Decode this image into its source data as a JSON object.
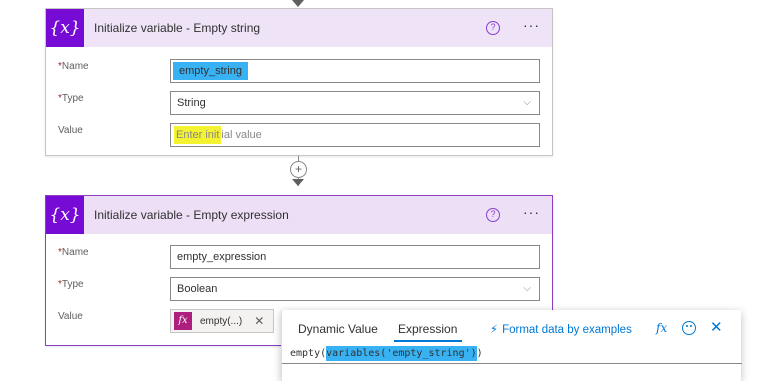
{
  "card1": {
    "title": "Initialize variable - Empty string",
    "icon_text": "{x}",
    "name_label": "Name",
    "name_value": "empty_string",
    "type_label": "Type",
    "type_value": "String",
    "value_label": "Value",
    "value_placeholder": "Enter initial value"
  },
  "card2": {
    "title": "Initialize variable - Empty expression",
    "icon_text": "{x}",
    "name_label": "Name",
    "name_value": "empty_expression",
    "type_label": "Type",
    "type_value": "Boolean",
    "value_label": "Value",
    "token_text": "empty(...)",
    "token_badge": "fx"
  },
  "popup": {
    "tab_dynamic": "Dynamic Value",
    "tab_expression": "Expression",
    "format_label": "Format data by examples",
    "fx_label": "fx",
    "expression_prefix": "empty(",
    "expression_highlight": "variables('empty_string')",
    "expression_suffix": ")"
  },
  "icons": {
    "help": "help-icon",
    "more": "more-icon",
    "chevron": "chevron-down-icon",
    "plus": "plus-icon",
    "close": "close-icon",
    "smile": "smile-icon"
  },
  "colors": {
    "accent": "#770bd6",
    "header_bg": "#eee3f7",
    "highlight_blue": "#38b2f2",
    "highlight_yellow": "#f3f332",
    "link": "#0078d4"
  }
}
